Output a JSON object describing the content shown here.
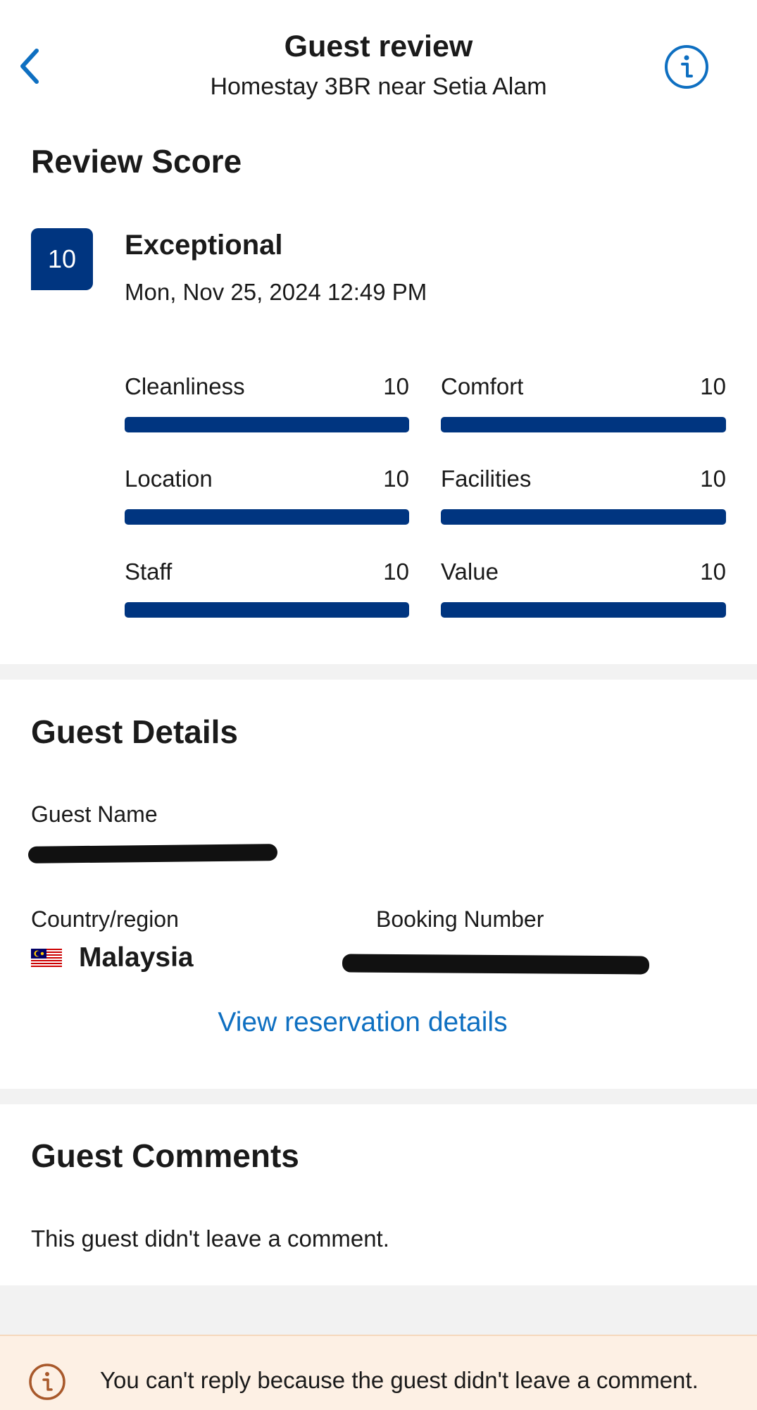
{
  "header": {
    "title": "Guest review",
    "subtitle": "Homestay 3BR near Setia Alam",
    "accent": "#0e6fc1"
  },
  "review_score": {
    "heading": "Review Score",
    "score": "10",
    "rating_word": "Exceptional",
    "date": "Mon, Nov 25, 2024 12:49 PM",
    "badge_color": "#003580",
    "categories": [
      {
        "label": "Cleanliness",
        "value": "10",
        "fraction": 1.0
      },
      {
        "label": "Comfort",
        "value": "10",
        "fraction": 1.0
      },
      {
        "label": "Location",
        "value": "10",
        "fraction": 1.0
      },
      {
        "label": "Facilities",
        "value": "10",
        "fraction": 1.0
      },
      {
        "label": "Staff",
        "value": "10",
        "fraction": 1.0
      },
      {
        "label": "Value",
        "value": "10",
        "fraction": 1.0
      }
    ]
  },
  "guest_details": {
    "heading": "Guest Details",
    "name_label": "Guest Name",
    "country_label": "Country/region",
    "country": "Malaysia",
    "booking_label": "Booking Number",
    "view_link": "View reservation details"
  },
  "guest_comments": {
    "heading": "Guest Comments",
    "text": "This guest didn't leave a comment."
  },
  "notice": {
    "text": "You can't reply because the guest didn't leave a comment."
  }
}
